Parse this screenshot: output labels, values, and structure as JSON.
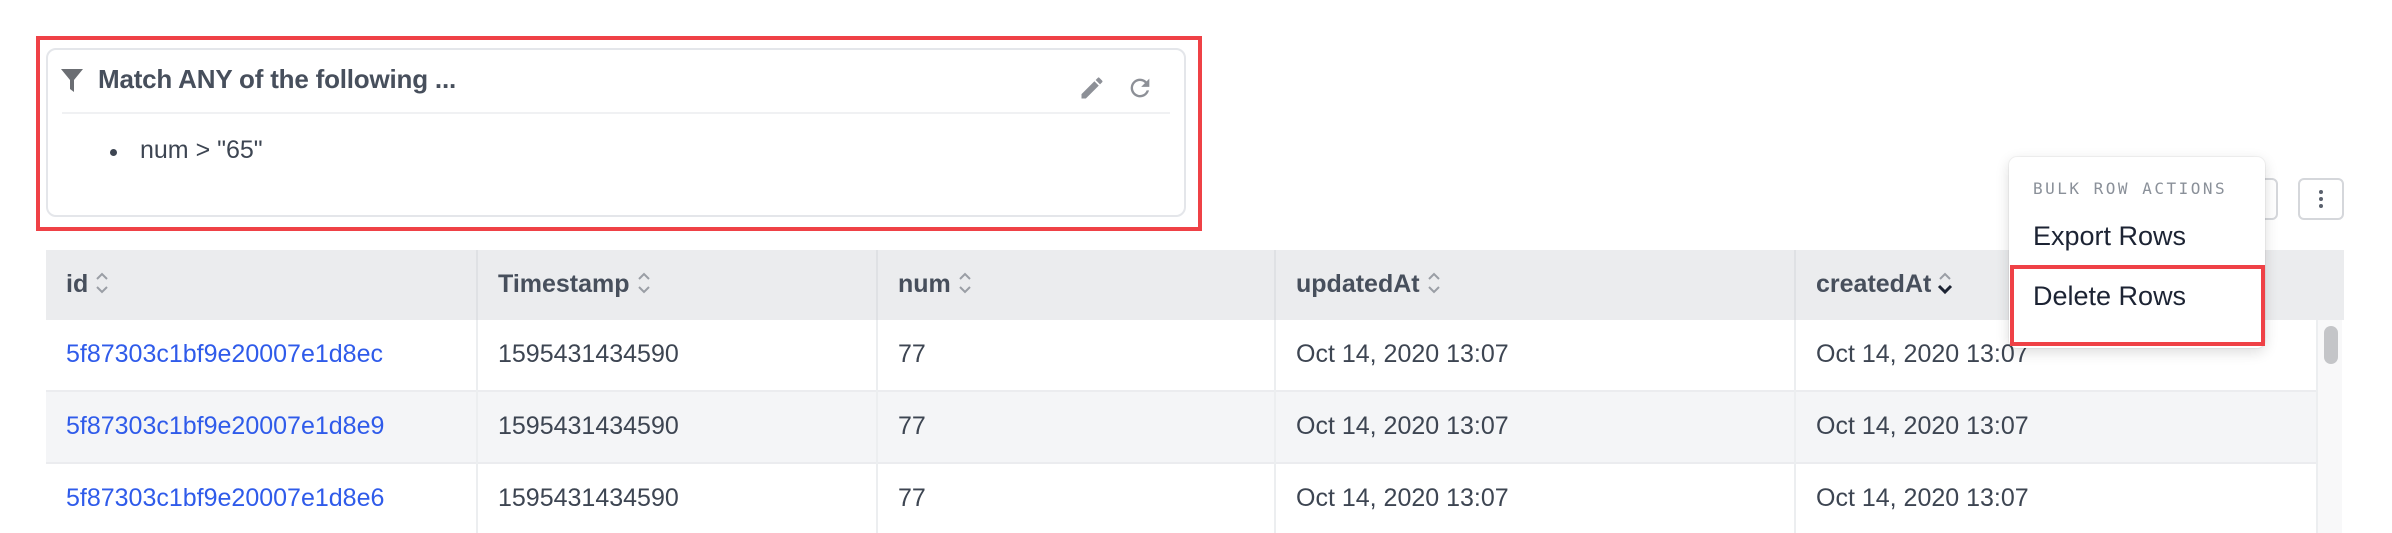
{
  "filter": {
    "icon": "filter-icon",
    "title": "Match ANY of the following ...",
    "conditions": [
      "num > \"65\""
    ],
    "actions": {
      "edit_icon": "pencil-icon",
      "refresh_icon": "refresh-icon"
    }
  },
  "toolbar": {
    "more_icon": "kebab-menu-icon"
  },
  "bulk_menu": {
    "heading": "BULK ROW ACTIONS",
    "items": [
      {
        "label": "Export Rows"
      },
      {
        "label": "Delete Rows",
        "highlighted": true
      }
    ]
  },
  "table": {
    "columns": [
      {
        "label": "id",
        "sort": "none"
      },
      {
        "label": "Timestamp",
        "sort": "none"
      },
      {
        "label": "num",
        "sort": "none"
      },
      {
        "label": "updatedAt",
        "sort": "none"
      },
      {
        "label": "createdAt",
        "sort": "descending"
      }
    ],
    "rows": [
      [
        "5f87303c1bf9e20007e1d8ec",
        "1595431434590",
        "77",
        "Oct 14, 2020 13:07",
        "Oct 14, 2020 13:07"
      ],
      [
        "5f87303c1bf9e20007e1d8e9",
        "1595431434590",
        "77",
        "Oct 14, 2020 13:07",
        "Oct 14, 2020 13:07"
      ],
      [
        "5f87303c1bf9e20007e1d8e6",
        "1595431434590",
        "77",
        "Oct 14, 2020 13:07",
        "Oct 14, 2020 13:07"
      ]
    ]
  },
  "colors": {
    "highlight": "#ef4146",
    "link": "#2f5bea",
    "header_bg": "#ebecee",
    "alt_row_bg": "#f4f5f7"
  }
}
